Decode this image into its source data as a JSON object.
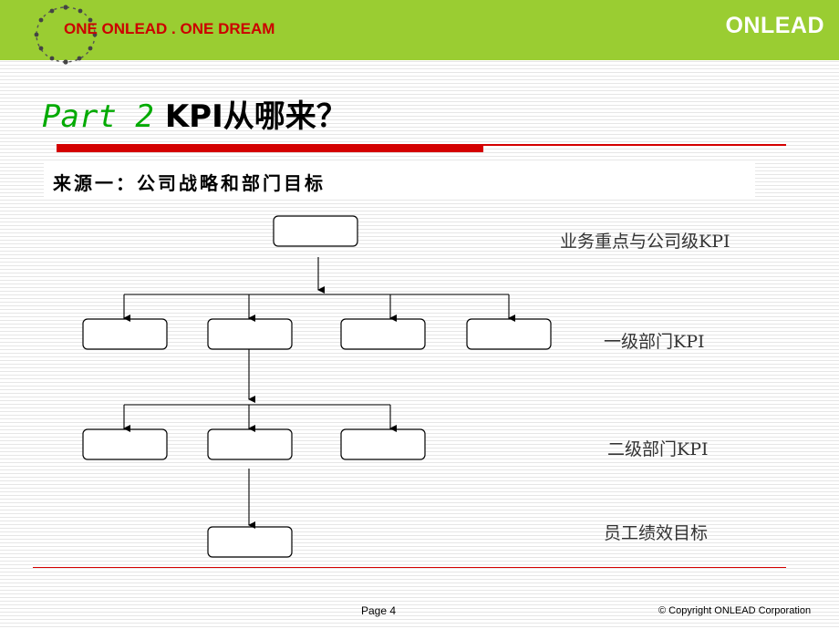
{
  "header": {
    "tagline": "ONE ONLEAD . ONE DREAM",
    "brand": "ONLEAD",
    "logo_icon": "people-ring-logo-icon",
    "background_color": "#9acd32"
  },
  "title": {
    "part": "Part 2",
    "main": "KPI从哪来？"
  },
  "subtitle": "来源一：公司战略和部门目标",
  "levels": [
    {
      "label": "业务重点与公司级KPI"
    },
    {
      "label": "一级部门KPI"
    },
    {
      "label": "二级部门KPI"
    },
    {
      "label": "员工绩效目标"
    }
  ],
  "footer": {
    "page": "Page 4",
    "copyright": "© Copyright ONLEAD Corporation"
  },
  "colors": {
    "accent_red": "#d40000",
    "title_green": "#00aa00"
  }
}
